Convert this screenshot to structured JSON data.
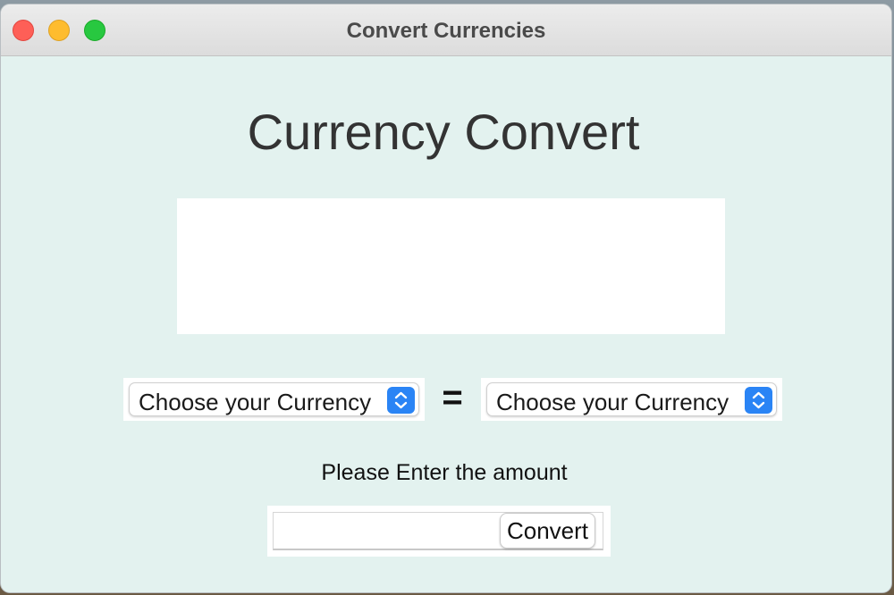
{
  "window": {
    "title": "Convert Currencies"
  },
  "main": {
    "heading": "Currency Convert",
    "result_text": "",
    "from_currency": {
      "selected": "Choose your Currency"
    },
    "equals_sign": "=",
    "to_currency": {
      "selected": "Choose your Currency"
    },
    "amount_prompt": "Please Enter the amount",
    "amount_value": "",
    "convert_label": "Convert"
  },
  "icons": {
    "traffic_lights": [
      "close-icon",
      "minimize-icon",
      "zoom-icon"
    ],
    "select_arrow": "updown-chevron-icon"
  },
  "colors": {
    "window_background": "#e3f2ef",
    "close": "#fe5f57",
    "minimize": "#febc2e",
    "zoom": "#28c840",
    "select_accent": "#2a84f5",
    "heading_text": "#333333"
  }
}
